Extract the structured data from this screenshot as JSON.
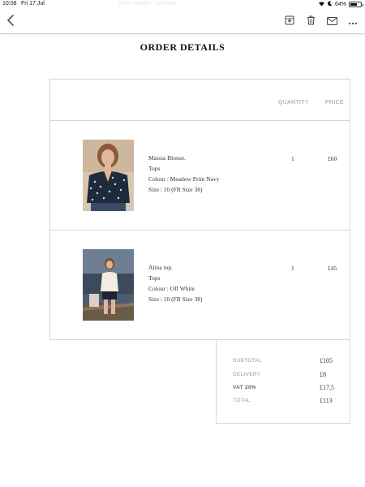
{
  "status_bar": {
    "time": "10:08",
    "date": "Fri 17 Jul",
    "faint_title": "Order Details - Sézane",
    "battery_level": 0.64,
    "battery": "64%"
  },
  "toolbar": {
    "back": "back",
    "save": "save-to-files",
    "delete": "delete",
    "mail": "mail",
    "more": "more"
  },
  "document": {
    "title": "ORDER DETAILS",
    "columns": {
      "quantity": "QUANTITY",
      "price": "PRICE"
    },
    "items": [
      {
        "name": "Massia Blouse.",
        "category": "Tops",
        "colour": "Colour : Meadow Print Navy",
        "size": "Size : 10 (FR Size 38)",
        "quantity": "1",
        "price": "£60"
      },
      {
        "name": "Alina top.",
        "category": "Tops",
        "colour": "Colour : Off White",
        "size": "Size : 10 (FR Size 38)",
        "quantity": "1",
        "price": "£45"
      }
    ],
    "totals": {
      "subtotal_label": "SUBTOTAL",
      "subtotal": "£105",
      "delivery_label": "DELIVERY",
      "delivery": "£8",
      "vat_label": "VAT 20%",
      "vat": "£17,5",
      "total_label": "TOTAL",
      "total": "£113"
    }
  }
}
